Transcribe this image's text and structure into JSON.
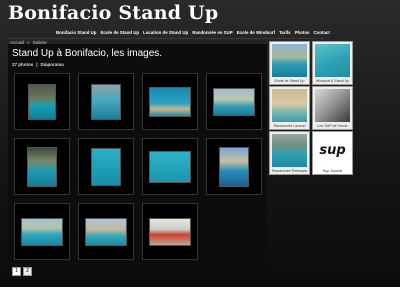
{
  "header": {
    "site_title": "Bonifacio Stand Up"
  },
  "nav": {
    "items": [
      "Bonifacio Stand Up",
      "Ecole de Stand Up",
      "Location de Stand Up",
      "Randonnée en SUP",
      "Ecole de Windsurf",
      "Tarifs",
      "Photos",
      "Contact"
    ]
  },
  "breadcrumb": {
    "home": "Accueil",
    "separator": "»",
    "current": "Galerie"
  },
  "gallery": {
    "title": "Stand Up à Bonifacio, les images.",
    "photo_count": "27 photos",
    "separator": "|",
    "slideshow_label": "Diaporama"
  },
  "pager": {
    "pages": [
      "1",
      "2"
    ]
  },
  "sidebar": {
    "cards": [
      {
        "caption": "Ecole de Stand Up"
      },
      {
        "caption": "Windsurf & Stand Up"
      },
      {
        "caption": "Randonnée Lavezzi"
      },
      {
        "caption": "Les SUP de l'école"
      },
      {
        "caption": "Randonnée Pertusato"
      },
      {
        "caption": "Sup Journal"
      }
    ],
    "logo_text": "sup"
  },
  "colors": {
    "background": "#141414",
    "panel": "#0d0d0d",
    "sea": "#2a9bb5"
  }
}
